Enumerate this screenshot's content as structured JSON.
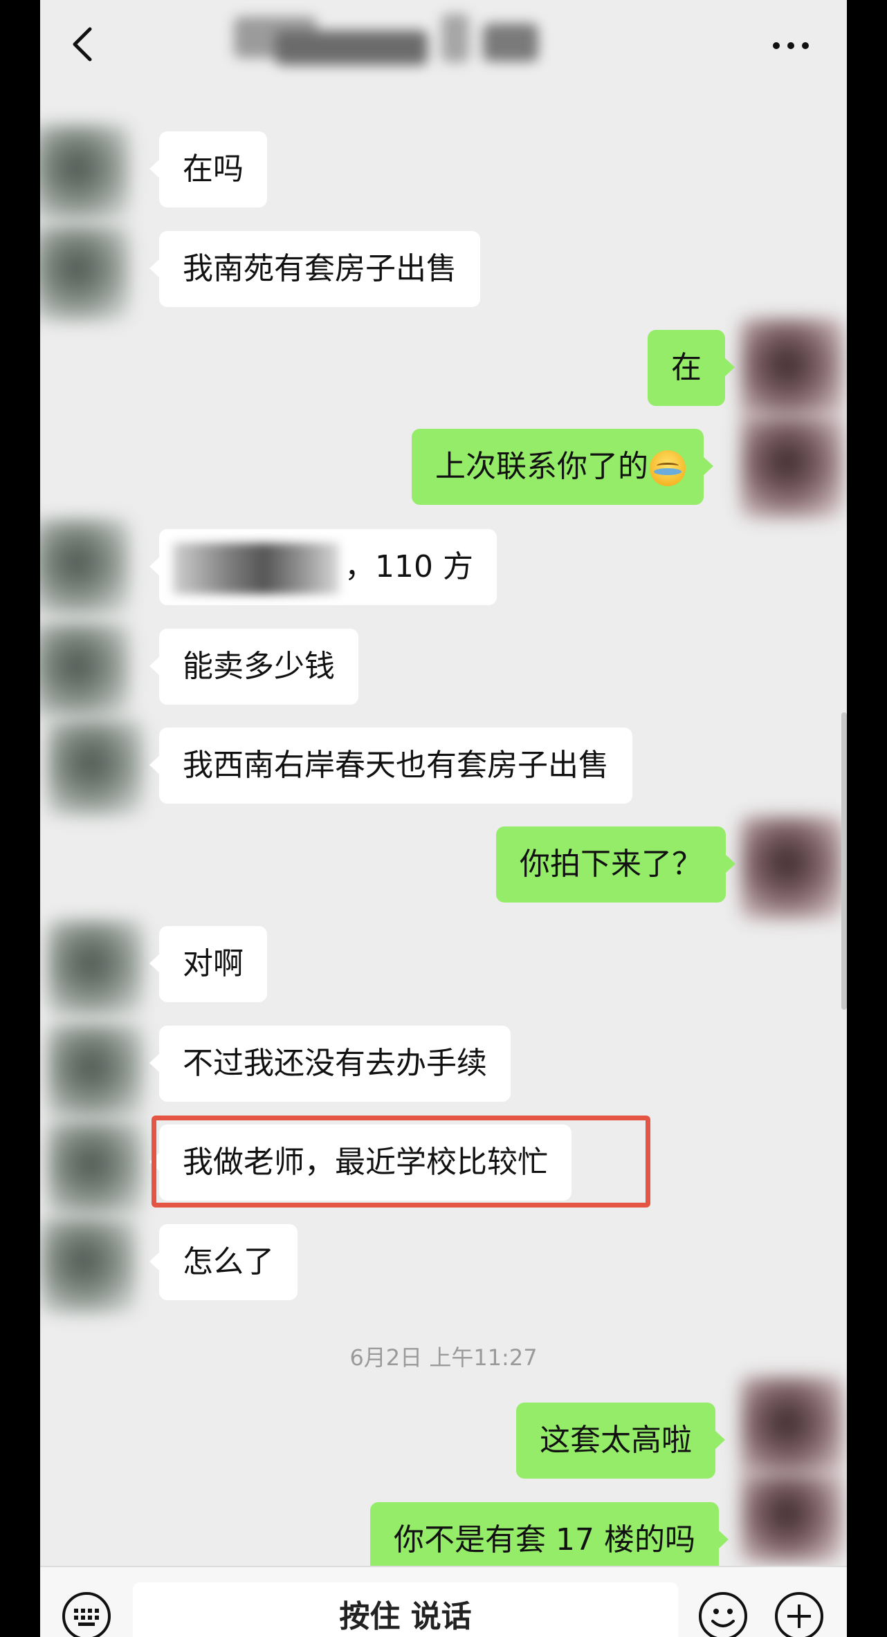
{
  "header": {
    "back_icon": "chevron-left-icon",
    "more_icon": "ellipsis-icon"
  },
  "messages": [
    {
      "side": "in",
      "text": "在吗"
    },
    {
      "side": "in",
      "text": "我南苑有套房子出售"
    },
    {
      "side": "out",
      "text": "在"
    },
    {
      "side": "out",
      "text": "上次联系你了的",
      "emoji": "laughing-crying-emoji"
    },
    {
      "side": "in",
      "text": "，110 方",
      "redacted_prefix": true
    },
    {
      "side": "in",
      "text": "能卖多少钱"
    },
    {
      "side": "in",
      "text": "我西南右岸春天也有套房子出售"
    },
    {
      "side": "out",
      "text": "你拍下来了？"
    },
    {
      "side": "in",
      "text": "对啊"
    },
    {
      "side": "in",
      "text": "不过我还没有去办手续"
    },
    {
      "side": "in",
      "text": "我做老师，最近学校比较忙",
      "highlighted": true
    },
    {
      "side": "in",
      "text": "怎么了"
    },
    {
      "side": "out",
      "text": "这套太高啦"
    },
    {
      "side": "out",
      "text": "你不是有套 17 楼的吗"
    }
  ],
  "timestamp": "6月2日 上午11:27",
  "input_bar": {
    "hold_to_talk": "按住 说话",
    "keyboard_icon": "keyboard-icon",
    "emoji_icon": "emoji-icon",
    "plus_icon": "plus-icon"
  },
  "colors": {
    "background": "#ededed",
    "incoming_bubble": "#ffffff",
    "outgoing_bubble": "#95ec69",
    "highlight_border": "#e45544"
  }
}
